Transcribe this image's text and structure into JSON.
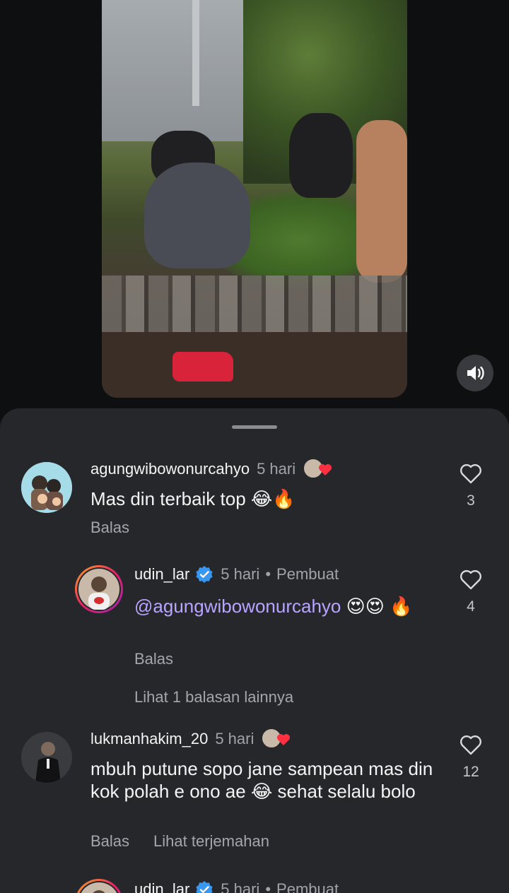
{
  "video": {
    "sound_icon": "speaker-icon"
  },
  "comments": [
    {
      "username": "agungwibowonurcahyo",
      "time": "5 hari",
      "text": "Mas din terbaik top 😂🔥",
      "reply_label": "Balas",
      "like_count": "3"
    },
    {
      "username": "udin_lar",
      "time": "5 hari",
      "creator_label": "Pembuat",
      "mention": "@agungwibowonurcahyo",
      "text": " 😍😍 🔥",
      "reply_label": "Balas",
      "like_count": "4",
      "more_replies": "Lihat 1 balasan lainnya"
    },
    {
      "username": "lukmanhakim_20",
      "time": "5 hari",
      "text": "mbuh putune sopo jane sampean mas din kok polah e ono ae 😂 sehat selalu bolo",
      "reply_label": "Balas",
      "translate_label": "Lihat terjemahan",
      "like_count": "12"
    },
    {
      "username": "udin_lar",
      "time": "5 hari",
      "creator_label": "Pembuat"
    }
  ],
  "colors": {
    "sheet": "#25272b",
    "mention": "#b9a4ff",
    "verified": "#3897f0",
    "heart": "#ff3040"
  }
}
